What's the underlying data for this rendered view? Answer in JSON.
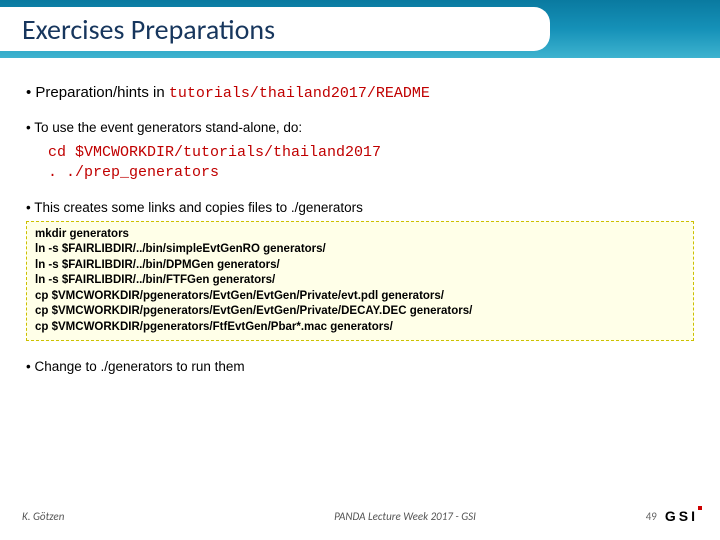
{
  "header": {
    "title": "Exercises Preparations"
  },
  "bullets": {
    "b1_prefix": "• Preparation/hints in ",
    "b1_mono": "tutorials/thailand2017/README",
    "b2": "• To use the event generators stand-alone, do:",
    "code1": "cd $VMCWORKDIR/tutorials/thailand2017\n. ./prep_generators",
    "b3": "• This creates some links and copies files to ./generators",
    "codebox": "mkdir generators\nln -s $FAIRLIBDIR/../bin/simpleEvtGenRO generators/\nln -s $FAIRLIBDIR/../bin/DPMGen generators/\nln -s $FAIRLIBDIR/../bin/FTFGen generators/\ncp $VMCWORKDIR/pgenerators/EvtGen/EvtGen/Private/evt.pdl generators/\ncp $VMCWORKDIR/pgenerators/EvtGen/EvtGen/Private/DECAY.DEC generators/\ncp $VMCWORKDIR/pgenerators/FtfEvtGen/Pbar*.mac generators/",
    "b4": "• Change to ./generators to run them"
  },
  "footer": {
    "author": "K. Götzen",
    "center": "PANDA Lecture Week 2017 - GSI",
    "page": "49",
    "logo": "GSI"
  }
}
